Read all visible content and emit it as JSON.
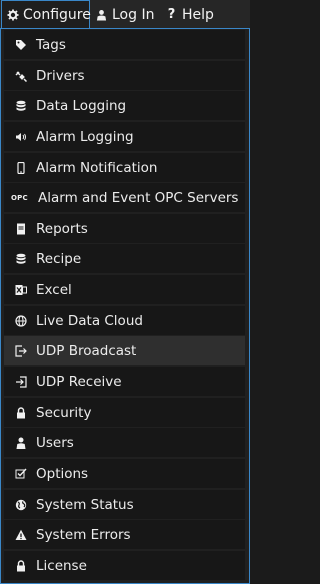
{
  "menubar": {
    "configure": "Configure",
    "login": "Log In",
    "help": "Help"
  },
  "menu": {
    "items": [
      {
        "label": "Tags",
        "icon": "tag-icon"
      },
      {
        "label": "Drivers",
        "icon": "plug-icon"
      },
      {
        "label": "Data Logging",
        "icon": "database-icon"
      },
      {
        "label": "Alarm Logging",
        "icon": "speaker-icon"
      },
      {
        "label": "Alarm Notification",
        "icon": "mobile-phone-icon"
      },
      {
        "label": "Alarm and Event OPC Servers",
        "icon": "opc-icon",
        "icon_text": "OPC"
      },
      {
        "label": "Reports",
        "icon": "report-icon"
      },
      {
        "label": "Recipe",
        "icon": "database-icon"
      },
      {
        "label": "Excel",
        "icon": "excel-icon"
      },
      {
        "label": "Live Data Cloud",
        "icon": "globe-icon"
      },
      {
        "label": "UDP Broadcast",
        "icon": "sign-out-icon"
      },
      {
        "label": "UDP Receive",
        "icon": "sign-in-icon"
      },
      {
        "label": "Security",
        "icon": "lock-icon"
      },
      {
        "label": "Users",
        "icon": "user-icon"
      },
      {
        "label": "Options",
        "icon": "checkbox-edit-icon"
      },
      {
        "label": "System Status",
        "icon": "globe-alt-icon"
      },
      {
        "label": "System Errors",
        "icon": "warning-icon"
      },
      {
        "label": "License",
        "icon": "lock-icon"
      }
    ]
  }
}
